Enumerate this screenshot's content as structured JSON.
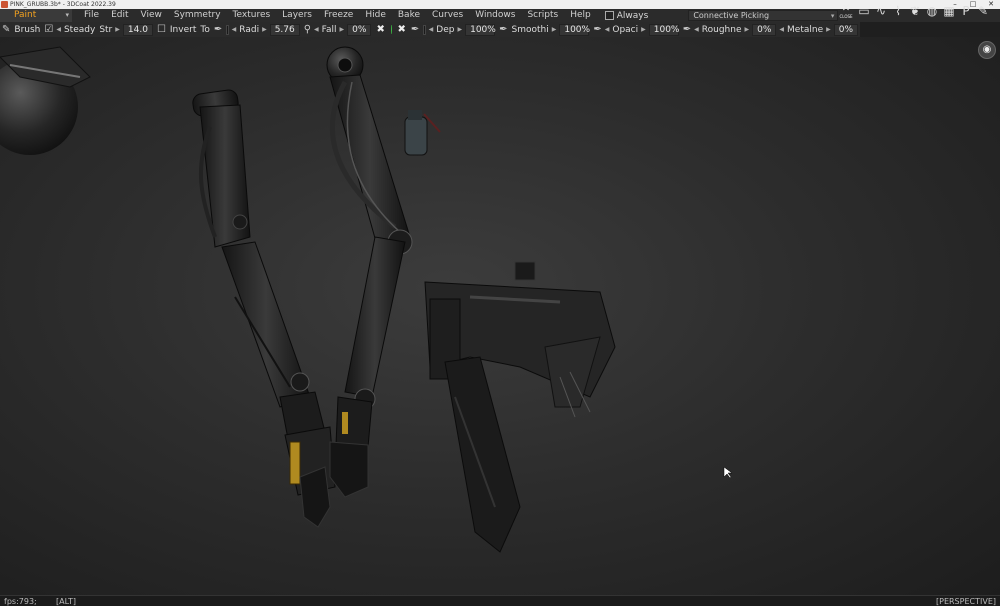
{
  "window": {
    "title": "PINK_GRUBB.3b* - 3DCoat 2022.39",
    "minimize": "–",
    "maximize": "□",
    "close": "✕"
  },
  "menubar": {
    "mode": "Paint",
    "items": [
      "File",
      "Edit",
      "View",
      "Symmetry",
      "Textures",
      "Layers",
      "Freeze",
      "Hide",
      "Bake",
      "Curves",
      "Windows",
      "Scripts",
      "Help"
    ],
    "always_label": "Always",
    "picking": "Connective Picking",
    "close_label": "CLOSE"
  },
  "toolbar": {
    "brush": "Brush",
    "steady": "Steady",
    "steady_str": "Str",
    "steady_value": "14.0",
    "invert": "Invert",
    "to": "To",
    "radius_label": "Radi",
    "radius_value": "5.76",
    "falloff_label": "Fall",
    "falloff_value": "0%",
    "depth_label": "Dep",
    "depth_value": "100%",
    "smooth_label": "Smoothi",
    "smooth_value": "100%",
    "opacity_label": "Opaci",
    "opacity_value": "100%",
    "roughness_label": "Roughne",
    "roughness_value": "0%",
    "metalness_label": "Metalne",
    "metalness_value": "0%"
  },
  "status": {
    "fps": "fps:793;",
    "key": "[ALT]",
    "projection": "[PERSPECTIVE]"
  }
}
